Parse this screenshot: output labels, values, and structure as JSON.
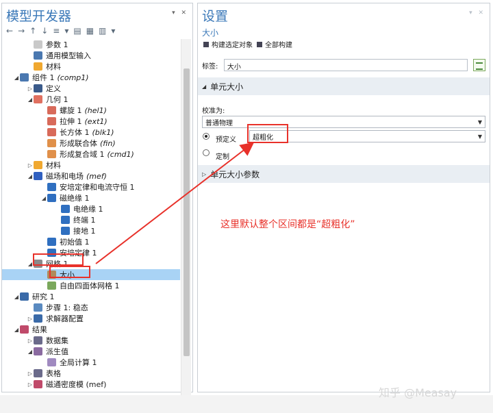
{
  "left_panel": {
    "title": "模型开发器",
    "controls": "▾ ✕"
  },
  "toolbar": [
    "←",
    "→",
    "↑",
    "↓",
    "≡",
    "▾",
    "▤",
    "▦",
    "▥",
    "▾"
  ],
  "tree": [
    {
      "label": "参数 1",
      "tag": "",
      "indent": 4,
      "toggle": "",
      "icon": "#c9c9c9"
    },
    {
      "label": "通用模型输入",
      "tag": "",
      "indent": 4,
      "toggle": "",
      "icon": "#4a78b0"
    },
    {
      "label": "材料",
      "tag": "",
      "indent": 4,
      "toggle": "",
      "icon": "#f0a830"
    },
    {
      "label": "组件 1",
      "tag": "(comp1)",
      "indent": 2,
      "toggle": "◢",
      "icon": "#4a78b0"
    },
    {
      "label": "定义",
      "tag": "",
      "indent": 4,
      "toggle": "▷",
      "icon": "#3a5a8a"
    },
    {
      "label": "几何 1",
      "tag": "",
      "indent": 4,
      "toggle": "◢",
      "icon": "#e07060"
    },
    {
      "label": "螺旋 1",
      "tag": "(hel1)",
      "indent": 6,
      "toggle": "",
      "icon": "#d86a5a"
    },
    {
      "label": "拉伸 1",
      "tag": "(ext1)",
      "indent": 6,
      "toggle": "",
      "icon": "#d86a5a"
    },
    {
      "label": "长方体 1",
      "tag": "(blk1)",
      "indent": 6,
      "toggle": "",
      "icon": "#d86a5a"
    },
    {
      "label": "形成联合体",
      "tag": "(fin)",
      "indent": 6,
      "toggle": "",
      "icon": "#e0904a"
    },
    {
      "label": "形成复合域 1",
      "tag": "(cmd1)",
      "indent": 6,
      "toggle": "",
      "icon": "#e0904a"
    },
    {
      "label": "材料",
      "tag": "",
      "indent": 4,
      "toggle": "▷",
      "icon": "#f0a830"
    },
    {
      "label": "磁场和电场",
      "tag": "(mef)",
      "indent": 4,
      "toggle": "◢",
      "icon": "#3060c0"
    },
    {
      "label": "安培定律和电流守恒 1",
      "tag": "",
      "indent": 6,
      "toggle": "",
      "icon": "#2f6fc0"
    },
    {
      "label": "磁绝缘 1",
      "tag": "",
      "indent": 6,
      "toggle": "◢",
      "icon": "#2f6fc0"
    },
    {
      "label": "电绝缘 1",
      "tag": "",
      "indent": 8,
      "toggle": "",
      "icon": "#2f6fc0"
    },
    {
      "label": "终端 1",
      "tag": "",
      "indent": 8,
      "toggle": "",
      "icon": "#2f6fc0"
    },
    {
      "label": "接地 1",
      "tag": "",
      "indent": 8,
      "toggle": "",
      "icon": "#2f6fc0"
    },
    {
      "label": "初始值 1",
      "tag": "",
      "indent": 6,
      "toggle": "",
      "icon": "#2f6fc0"
    },
    {
      "label": "安培定律 1",
      "tag": "",
      "indent": 6,
      "toggle": "",
      "icon": "#2f6fc0"
    },
    {
      "label": "网格 1",
      "tag": "",
      "indent": 4,
      "toggle": "◢",
      "icon": "#8a8a8a"
    },
    {
      "label": "大小",
      "tag": "",
      "indent": 6,
      "toggle": "",
      "icon": "#b08a5a"
    },
    {
      "label": "自由四面体网格 1",
      "tag": "",
      "indent": 6,
      "toggle": "",
      "icon": "#7aa85c"
    },
    {
      "label": "研究 1",
      "tag": "",
      "indent": 2,
      "toggle": "◢",
      "icon": "#3a6aa8"
    },
    {
      "label": "步骤 1: 稳态",
      "tag": "",
      "indent": 4,
      "toggle": "",
      "icon": "#5a8ac0"
    },
    {
      "label": "求解器配置",
      "tag": "",
      "indent": 4,
      "toggle": "▷",
      "icon": "#3a6aa8"
    },
    {
      "label": "结果",
      "tag": "",
      "indent": 2,
      "toggle": "◢",
      "icon": "#c04a6a"
    },
    {
      "label": "数据集",
      "tag": "",
      "indent": 4,
      "toggle": "▷",
      "icon": "#6a6a8a"
    },
    {
      "label": "派生值",
      "tag": "",
      "indent": 4,
      "toggle": "◢",
      "icon": "#8a6aa0"
    },
    {
      "label": "全局计算 1",
      "tag": "",
      "indent": 6,
      "toggle": "",
      "icon": "#a08ac0"
    },
    {
      "label": "表格",
      "tag": "",
      "indent": 4,
      "toggle": "▷",
      "icon": "#6a6a8a"
    },
    {
      "label": "磁通密度模 (mef)",
      "tag": "",
      "indent": 4,
      "toggle": "▷",
      "icon": "#c04a6a"
    }
  ],
  "settings": {
    "title": "设置",
    "controls": "▾ ✕",
    "subtitle": "大小",
    "build_selected": "构建选定对象",
    "build_all": "全部构建",
    "label_key": "标签:",
    "label_value": "大小",
    "section_element_size": "单元大小",
    "calibrate_for": "校准为:",
    "calibrate_value": "普通物理",
    "predefined_label": "预定义",
    "predefined_value": "超粗化",
    "custom_label": "定制",
    "section_params": "单元大小参数"
  },
  "annotation": "这里默认整个区间都是“超粗化”",
  "watermark": "知乎 @Measay",
  "colors": {
    "accent_title": "#3a78b8",
    "highlight": "#e8312a",
    "selected_row": "#a9d3f5"
  }
}
